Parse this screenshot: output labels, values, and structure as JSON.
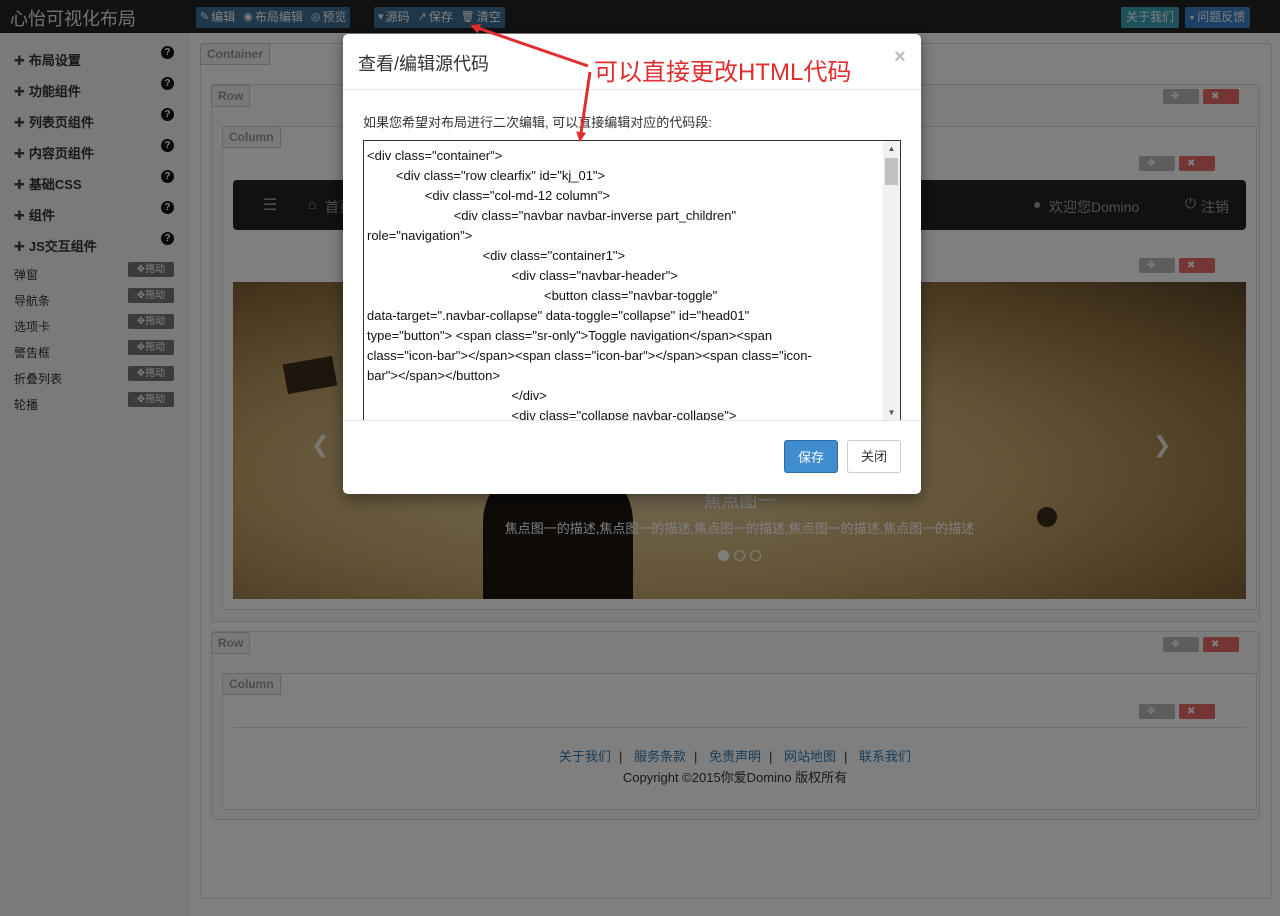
{
  "app": {
    "brand": "心怡可视化布局"
  },
  "toolbar": {
    "edit": "编辑",
    "layout_edit": "布局编辑",
    "preview": "预览",
    "source": "源码",
    "save": "保存",
    "clear": "清空",
    "about": "关于我们",
    "feedback": "问题反馈"
  },
  "sidebar": {
    "sections": [
      "布局设置",
      "功能组件",
      "列表页组件",
      "内容页组件",
      "基础CSS",
      "组件",
      "JS交互组件"
    ],
    "help_glyph": "?",
    "items": [
      "弹窗",
      "导航条",
      "选项卡",
      "警告框",
      "折叠列表",
      "轮播"
    ],
    "drag_label": "拖动"
  },
  "canvas": {
    "container_label": "Container",
    "row_label": "Row",
    "column_label": "Column",
    "move_label": "拖动",
    "delete_label": "删除",
    "navbar": {
      "home": "首页",
      "welcome": "欢迎您Domino",
      "logout": "注销"
    },
    "carousel": {
      "title": "焦点图一",
      "desc": "焦点图一的描述,焦点图一的描述,焦点图一的描述,焦点图一的描述,焦点图一的描述",
      "active_index": 0
    },
    "footer": {
      "links": [
        "关于我们",
        "服务条款",
        "免责声明",
        "网站地图",
        "联系我们"
      ],
      "copyright": "Copyright ©2015你爱Domino 版权所有"
    }
  },
  "modal": {
    "title": "查看/编辑源代码",
    "close_glyph": "×",
    "description": "如果您希望对布局进行二次编辑, 可以直接编辑对应的代码段:",
    "code": "<div class=\"container\">\n        <div class=\"row clearfix\" id=\"kj_01\">\n                <div class=\"col-md-12 column\">\n                        <div class=\"navbar navbar-inverse part_children\"\nrole=\"navigation\">\n                                <div class=\"container1\">\n                                        <div class=\"navbar-header\">\n                                                 <button class=\"navbar-toggle\"\ndata-target=\".navbar-collapse\" data-toggle=\"collapse\" id=\"head01\"\ntype=\"button\"> <span class=\"sr-only\">Toggle navigation</span><span\nclass=\"icon-bar\"></span><span class=\"icon-bar\"></span><span class=\"icon-\nbar\"></span></button>\n                                        </div>\n                                        <div class=\"collapse navbar-collapse\">",
    "save_label": "保存",
    "close_label": "关闭"
  },
  "annotation": {
    "text": "可以直接更改HTML代码",
    "color": "#e02d2d"
  }
}
